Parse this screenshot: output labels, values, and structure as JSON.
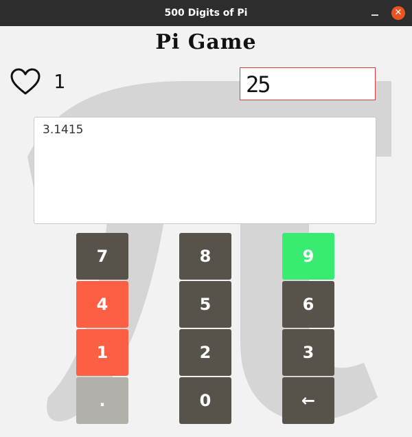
{
  "window": {
    "title": "500 Digits of Pi",
    "minimize_icon": "minimize-icon",
    "close_icon": "close-icon",
    "close_glyph": "✕",
    "accent_color": "#e95420"
  },
  "game": {
    "title": "Pi Game",
    "lives_icon": "heart-icon",
    "lives": "1",
    "score": "25",
    "digits": "3.1415",
    "background_icon": "pi-symbol-icon"
  },
  "keypad": {
    "rows": [
      [
        {
          "label": "7",
          "state": "default"
        },
        {
          "label": "8",
          "state": "default"
        },
        {
          "label": "9",
          "state": "correct"
        }
      ],
      [
        {
          "label": "4",
          "state": "wrong"
        },
        {
          "label": "5",
          "state": "default"
        },
        {
          "label": "6",
          "state": "default"
        }
      ],
      [
        {
          "label": "1",
          "state": "wrong"
        },
        {
          "label": "2",
          "state": "default"
        },
        {
          "label": "3",
          "state": "default"
        }
      ],
      [
        {
          "label": ".",
          "state": "disabled"
        },
        {
          "label": "0",
          "state": "default"
        },
        {
          "label": "←",
          "state": "default"
        }
      ]
    ],
    "colors": {
      "default": "#57524a",
      "wrong": "#fd5f45",
      "correct": "#37ec70",
      "disabled": "#b2b0aa"
    }
  }
}
